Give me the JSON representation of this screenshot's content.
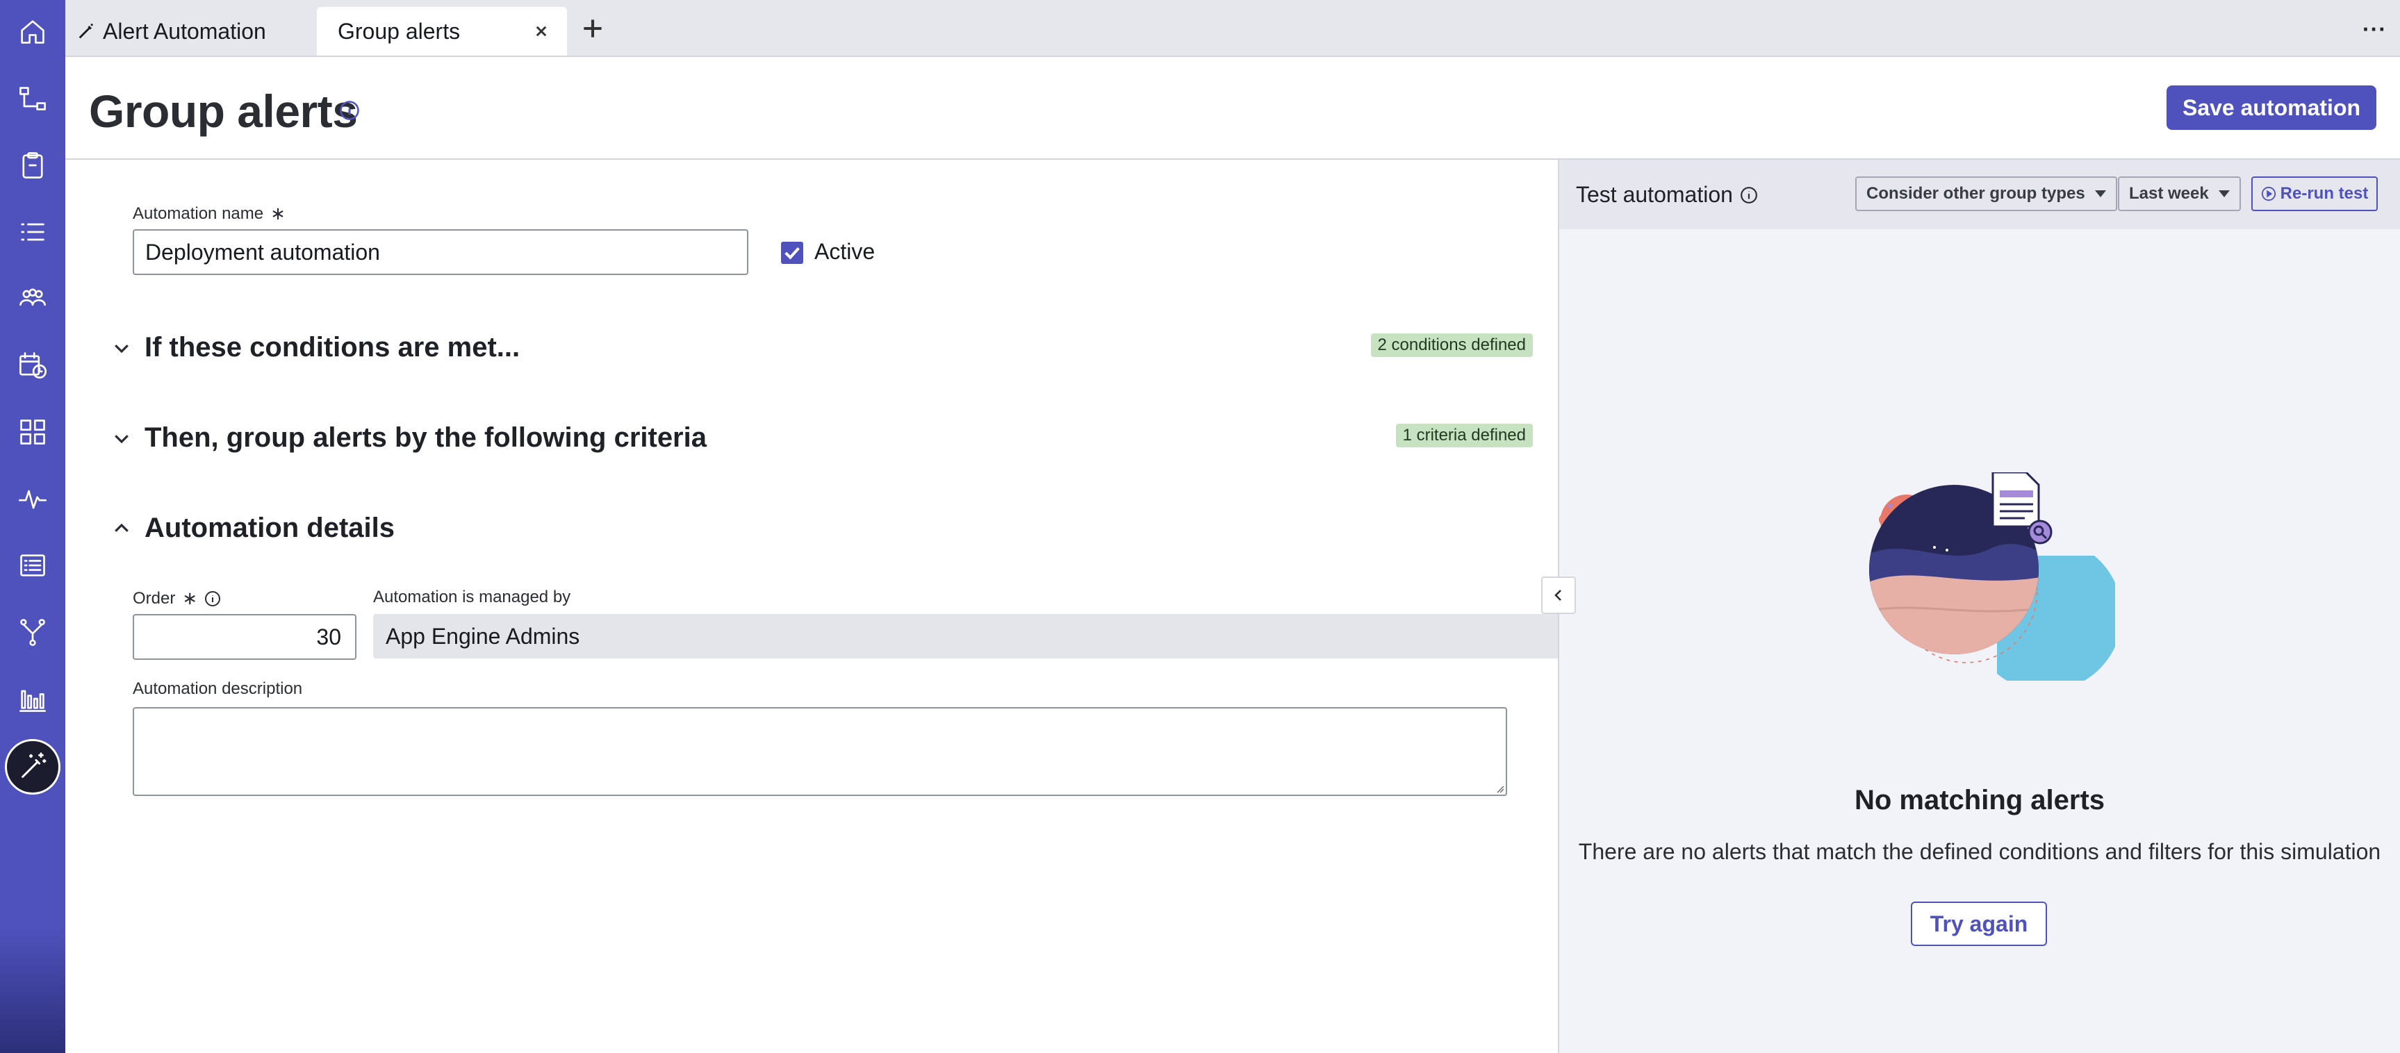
{
  "nav_rail": {
    "items": [
      {
        "icon": "home-icon"
      },
      {
        "icon": "workflow-icon"
      },
      {
        "icon": "clipboard-icon"
      },
      {
        "icon": "list-icon"
      },
      {
        "icon": "groups-icon"
      },
      {
        "icon": "calendar-clock-icon"
      },
      {
        "icon": "grid-icon"
      },
      {
        "icon": "pulse-icon"
      },
      {
        "icon": "records-icon"
      },
      {
        "icon": "branch-icon"
      },
      {
        "icon": "bar-chart-icon"
      },
      {
        "icon": "magic-wand-icon",
        "active": true
      }
    ],
    "color": "#4f52bd"
  },
  "tabs": [
    {
      "label": "Alert Automation",
      "icon": "magic-wand-icon"
    },
    {
      "label": "Group alerts",
      "active": true
    }
  ],
  "header": {
    "title": "Group alerts",
    "save_label": "Save automation"
  },
  "form": {
    "name_label": "Automation name",
    "required_mark": "∗",
    "name_value": "Deployment automation",
    "active_label": "Active",
    "active_checked": true,
    "sections": [
      {
        "title": "If these conditions are met...",
        "badge": "2 conditions defined",
        "expanded": false
      },
      {
        "title": "Then, group alerts by the following criteria",
        "badge": "1 criteria defined",
        "expanded": false
      },
      {
        "title": "Automation details",
        "badge": "",
        "expanded": true
      }
    ],
    "order_label": "Order",
    "order_value": "30",
    "managed_label": "Automation is managed by",
    "managed_value": "App Engine Admins",
    "description_label": "Automation description",
    "description_value": ""
  },
  "test_panel": {
    "title": "Test automation",
    "group_filter": "Consider other group types",
    "time_filter": "Last week",
    "rerun_label": "Re-run test",
    "empty_title": "No matching alerts",
    "empty_text": "There are no alerts that match the defined conditions and filters for this simulation",
    "try_again_label": "Try again"
  },
  "colors": {
    "accent": "#4f52bd",
    "badge_bg": "#c7e2c0",
    "panel_bg": "#f2f3f8"
  }
}
